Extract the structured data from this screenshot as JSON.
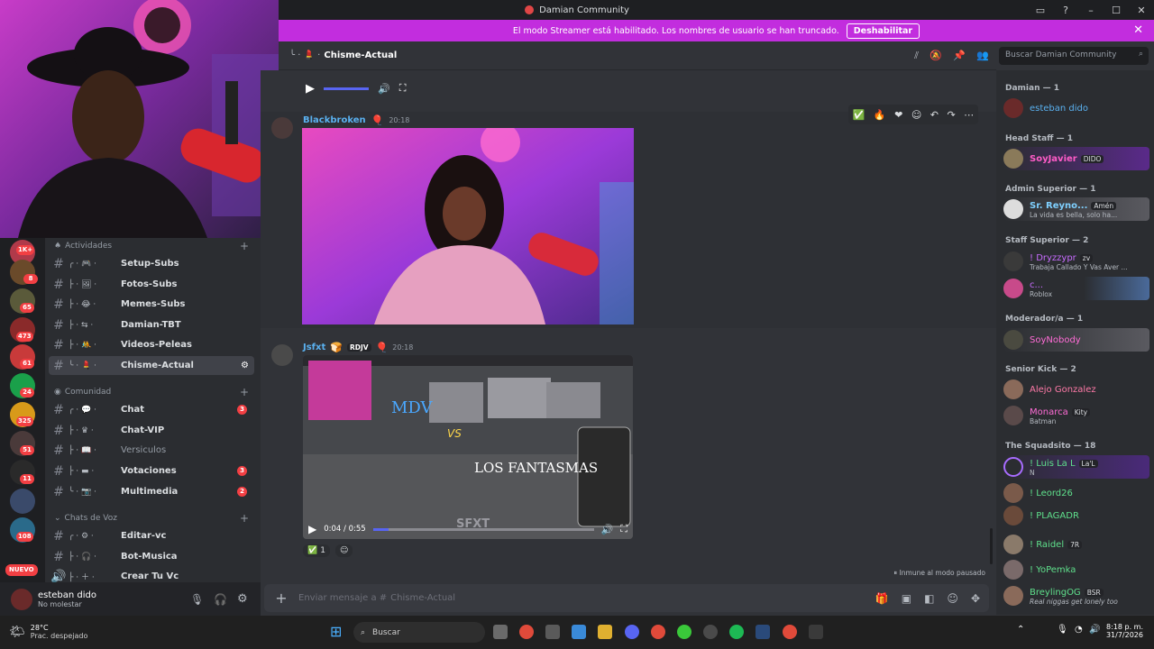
{
  "window": {
    "title": "Damian Community"
  },
  "banner": {
    "text": "El modo Streamer está habilitado. Los nombres de usuario se han truncado.",
    "button": "Deshabilitar"
  },
  "channel_header": {
    "name": "Chisme-Actual",
    "search_placeholder": "Buscar Damian Community"
  },
  "server_badges": [
    "1K+",
    "8",
    "65",
    "473",
    "61",
    "24",
    "325",
    "51",
    "11",
    "108"
  ],
  "server_new": "NUEVO",
  "categories": {
    "actividades": "Actividades",
    "comunidad": "Comunidad",
    "voz": "Chats de Voz"
  },
  "channels": [
    {
      "name": "Setup-Subs",
      "count": ""
    },
    {
      "name": "Fotos-Subs",
      "count": ""
    },
    {
      "name": "Memes-Subs",
      "count": ""
    },
    {
      "name": "Damian-TBT",
      "count": ""
    },
    {
      "name": "Videos-Peleas",
      "count": ""
    },
    {
      "name": "Chisme-Actual",
      "count": ""
    },
    {
      "name": "Chat",
      "count": "3"
    },
    {
      "name": "Chat-VIP",
      "count": ""
    },
    {
      "name": "Versiculos",
      "count": ""
    },
    {
      "name": "Votaciones",
      "count": "3"
    },
    {
      "name": "Multimedia",
      "count": "2"
    },
    {
      "name": "Editar-vc",
      "count": ""
    },
    {
      "name": "Bot-Musica",
      "count": ""
    },
    {
      "name": "Crear Tu Vc",
      "count": ""
    }
  ],
  "user": {
    "name": "esteban dido",
    "status": "No molestar"
  },
  "messages": [
    {
      "author": "Blackbroken",
      "time": "20:18",
      "author_color": "#5ab1f0"
    },
    {
      "author": "Jsfxt",
      "tag": "RDJV",
      "time": "20:18",
      "author_color": "#5ab1f0",
      "video": {
        "title_a": "MDV",
        "vs": "VS",
        "title_b": "LOS FANTASMAS",
        "time": "0:04 / 0:55",
        "watermark": "SFXT"
      },
      "reaction_count": "1"
    }
  ],
  "paused_notice": "Inmune al modo pausado",
  "composer_placeholder": "Enviar mensaje a #",
  "member_groups": [
    {
      "label": "Damian — 1",
      "members": [
        {
          "name": "esteban dido",
          "color": "#5ab1f0",
          "sub": ""
        }
      ]
    },
    {
      "label": "Head Staff — 1",
      "members": [
        {
          "name": "SoyJavier",
          "color": "#ff5cc8",
          "tag": "DIDO",
          "sub": ""
        }
      ]
    },
    {
      "label": "Admin Superior — 1",
      "members": [
        {
          "name": "Sr. Reyno...",
          "color": "#7fd0ff",
          "tag": "Amén",
          "sub": "La vida es bella, solo ha..."
        }
      ]
    },
    {
      "label": "Staff Superior — 2",
      "members": [
        {
          "name": "! Dryzzypr",
          "color": "#c86cff",
          "tag": "zv",
          "sub": "Trabaja Callado Y Vas Aver ..."
        },
        {
          "name": "c...",
          "color": "#c86cff",
          "sub": "Roblox"
        }
      ]
    },
    {
      "label": "Moderador/a — 1",
      "members": [
        {
          "name": "SoyNobody",
          "color": "#ff6cd6",
          "sub": ""
        }
      ]
    },
    {
      "label": "Senior Kick — 2",
      "members": [
        {
          "name": "Alejo Gonzalez",
          "color": "#ff7aa8",
          "sub": ""
        },
        {
          "name": "Monarca",
          "color": "#ff6cd6",
          "tag": "Kity",
          "sub": "Batman"
        }
      ]
    },
    {
      "label": "The Squadsito — 18",
      "members": [
        {
          "name": "! Luis La L",
          "color": "#5fe08c",
          "tag": "La'L",
          "sub": "N"
        },
        {
          "name": "! Leord26",
          "color": "#5fe08c",
          "sub": ""
        },
        {
          "name": "! PLAGADR",
          "color": "#5fe08c",
          "sub": ""
        },
        {
          "name": "! Raidel",
          "color": "#5fe08c",
          "tag": "7R",
          "sub": ""
        },
        {
          "name": "! YoPemka",
          "color": "#5fe08c",
          "sub": ""
        },
        {
          "name": "BreylingOG",
          "color": "#5fe08c",
          "tag": "BSR",
          "sub": "Real niggas get lonely too"
        }
      ]
    }
  ],
  "taskbar": {
    "weather_temp": "28°C",
    "weather_desc": "Prac. despejado",
    "search": "Buscar",
    "time": "8:18 p. m.",
    "date": "31/7/2026"
  },
  "colors": {
    "accent_banner": "#c22dde",
    "bg": "#313338",
    "sidebar": "#2b2d31",
    "dark": "#1e1f22"
  }
}
